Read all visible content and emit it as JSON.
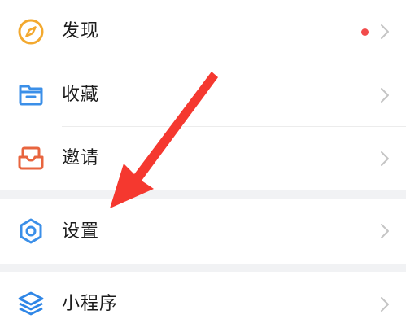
{
  "menu": {
    "discover": {
      "label": "发现",
      "icon": "compass-icon",
      "has_badge_dot": true
    },
    "favorites": {
      "label": "收藏",
      "icon": "box-icon"
    },
    "invite": {
      "label": "邀请",
      "icon": "inbox-tray-icon"
    },
    "settings": {
      "label": "设置",
      "icon": "gear-icon"
    },
    "mini_programs": {
      "label": "小程序",
      "icon": "layers-icon"
    }
  },
  "colors": {
    "compass": "#f3a92f",
    "favorites": "#3b8fe8",
    "invite": "#e8653f",
    "settings": "#3b8fe8",
    "mini_programs": "#2f86e6",
    "badge_dot": "#f24b4b",
    "annotation_arrow": "#f5382f",
    "chevron": "#c4c4c4",
    "separator": "#f1f2f4"
  }
}
